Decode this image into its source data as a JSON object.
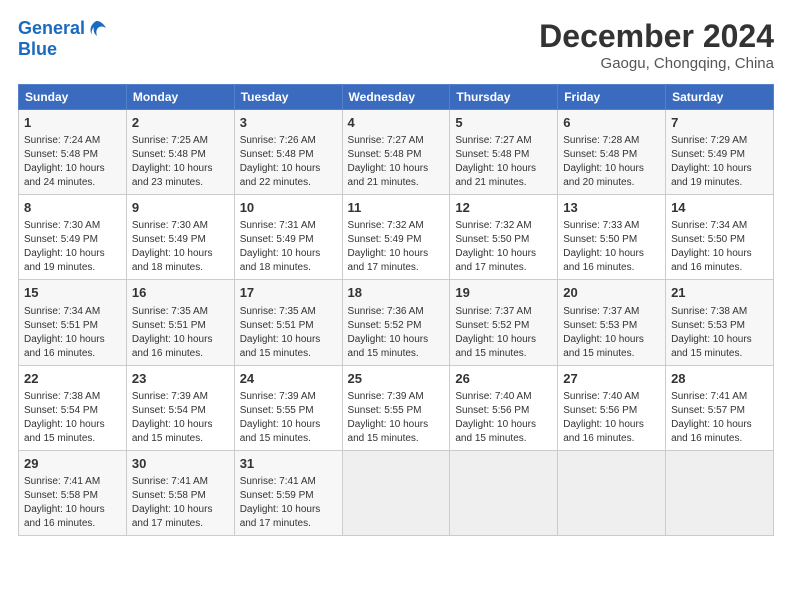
{
  "header": {
    "logo_general": "General",
    "logo_blue": "Blue",
    "month_year": "December 2024",
    "location": "Gaogu, Chongqing, China"
  },
  "calendar": {
    "columns": [
      "Sunday",
      "Monday",
      "Tuesday",
      "Wednesday",
      "Thursday",
      "Friday",
      "Saturday"
    ],
    "weeks": [
      [
        {
          "day": "",
          "info": ""
        },
        {
          "day": "2",
          "info": "Sunrise: 7:25 AM\nSunset: 5:48 PM\nDaylight: 10 hours\nand 23 minutes."
        },
        {
          "day": "3",
          "info": "Sunrise: 7:26 AM\nSunset: 5:48 PM\nDaylight: 10 hours\nand 22 minutes."
        },
        {
          "day": "4",
          "info": "Sunrise: 7:27 AM\nSunset: 5:48 PM\nDaylight: 10 hours\nand 21 minutes."
        },
        {
          "day": "5",
          "info": "Sunrise: 7:27 AM\nSunset: 5:48 PM\nDaylight: 10 hours\nand 21 minutes."
        },
        {
          "day": "6",
          "info": "Sunrise: 7:28 AM\nSunset: 5:48 PM\nDaylight: 10 hours\nand 20 minutes."
        },
        {
          "day": "7",
          "info": "Sunrise: 7:29 AM\nSunset: 5:49 PM\nDaylight: 10 hours\nand 19 minutes."
        }
      ],
      [
        {
          "day": "1",
          "info": "Sunrise: 7:24 AM\nSunset: 5:48 PM\nDaylight: 10 hours\nand 24 minutes."
        },
        {
          "day": "",
          "info": ""
        },
        {
          "day": "",
          "info": ""
        },
        {
          "day": "",
          "info": ""
        },
        {
          "day": "",
          "info": ""
        },
        {
          "day": "",
          "info": ""
        },
        {
          "day": "",
          "info": ""
        }
      ],
      [
        {
          "day": "8",
          "info": "Sunrise: 7:30 AM\nSunset: 5:49 PM\nDaylight: 10 hours\nand 19 minutes."
        },
        {
          "day": "9",
          "info": "Sunrise: 7:30 AM\nSunset: 5:49 PM\nDaylight: 10 hours\nand 18 minutes."
        },
        {
          "day": "10",
          "info": "Sunrise: 7:31 AM\nSunset: 5:49 PM\nDaylight: 10 hours\nand 18 minutes."
        },
        {
          "day": "11",
          "info": "Sunrise: 7:32 AM\nSunset: 5:49 PM\nDaylight: 10 hours\nand 17 minutes."
        },
        {
          "day": "12",
          "info": "Sunrise: 7:32 AM\nSunset: 5:50 PM\nDaylight: 10 hours\nand 17 minutes."
        },
        {
          "day": "13",
          "info": "Sunrise: 7:33 AM\nSunset: 5:50 PM\nDaylight: 10 hours\nand 16 minutes."
        },
        {
          "day": "14",
          "info": "Sunrise: 7:34 AM\nSunset: 5:50 PM\nDaylight: 10 hours\nand 16 minutes."
        }
      ],
      [
        {
          "day": "15",
          "info": "Sunrise: 7:34 AM\nSunset: 5:51 PM\nDaylight: 10 hours\nand 16 minutes."
        },
        {
          "day": "16",
          "info": "Sunrise: 7:35 AM\nSunset: 5:51 PM\nDaylight: 10 hours\nand 16 minutes."
        },
        {
          "day": "17",
          "info": "Sunrise: 7:35 AM\nSunset: 5:51 PM\nDaylight: 10 hours\nand 15 minutes."
        },
        {
          "day": "18",
          "info": "Sunrise: 7:36 AM\nSunset: 5:52 PM\nDaylight: 10 hours\nand 15 minutes."
        },
        {
          "day": "19",
          "info": "Sunrise: 7:37 AM\nSunset: 5:52 PM\nDaylight: 10 hours\nand 15 minutes."
        },
        {
          "day": "20",
          "info": "Sunrise: 7:37 AM\nSunset: 5:53 PM\nDaylight: 10 hours\nand 15 minutes."
        },
        {
          "day": "21",
          "info": "Sunrise: 7:38 AM\nSunset: 5:53 PM\nDaylight: 10 hours\nand 15 minutes."
        }
      ],
      [
        {
          "day": "22",
          "info": "Sunrise: 7:38 AM\nSunset: 5:54 PM\nDaylight: 10 hours\nand 15 minutes."
        },
        {
          "day": "23",
          "info": "Sunrise: 7:39 AM\nSunset: 5:54 PM\nDaylight: 10 hours\nand 15 minutes."
        },
        {
          "day": "24",
          "info": "Sunrise: 7:39 AM\nSunset: 5:55 PM\nDaylight: 10 hours\nand 15 minutes."
        },
        {
          "day": "25",
          "info": "Sunrise: 7:39 AM\nSunset: 5:55 PM\nDaylight: 10 hours\nand 15 minutes."
        },
        {
          "day": "26",
          "info": "Sunrise: 7:40 AM\nSunset: 5:56 PM\nDaylight: 10 hours\nand 15 minutes."
        },
        {
          "day": "27",
          "info": "Sunrise: 7:40 AM\nSunset: 5:56 PM\nDaylight: 10 hours\nand 16 minutes."
        },
        {
          "day": "28",
          "info": "Sunrise: 7:41 AM\nSunset: 5:57 PM\nDaylight: 10 hours\nand 16 minutes."
        }
      ],
      [
        {
          "day": "29",
          "info": "Sunrise: 7:41 AM\nSunset: 5:58 PM\nDaylight: 10 hours\nand 16 minutes."
        },
        {
          "day": "30",
          "info": "Sunrise: 7:41 AM\nSunset: 5:58 PM\nDaylight: 10 hours\nand 17 minutes."
        },
        {
          "day": "31",
          "info": "Sunrise: 7:41 AM\nSunset: 5:59 PM\nDaylight: 10 hours\nand 17 minutes."
        },
        {
          "day": "",
          "info": ""
        },
        {
          "day": "",
          "info": ""
        },
        {
          "day": "",
          "info": ""
        },
        {
          "day": "",
          "info": ""
        }
      ]
    ]
  }
}
